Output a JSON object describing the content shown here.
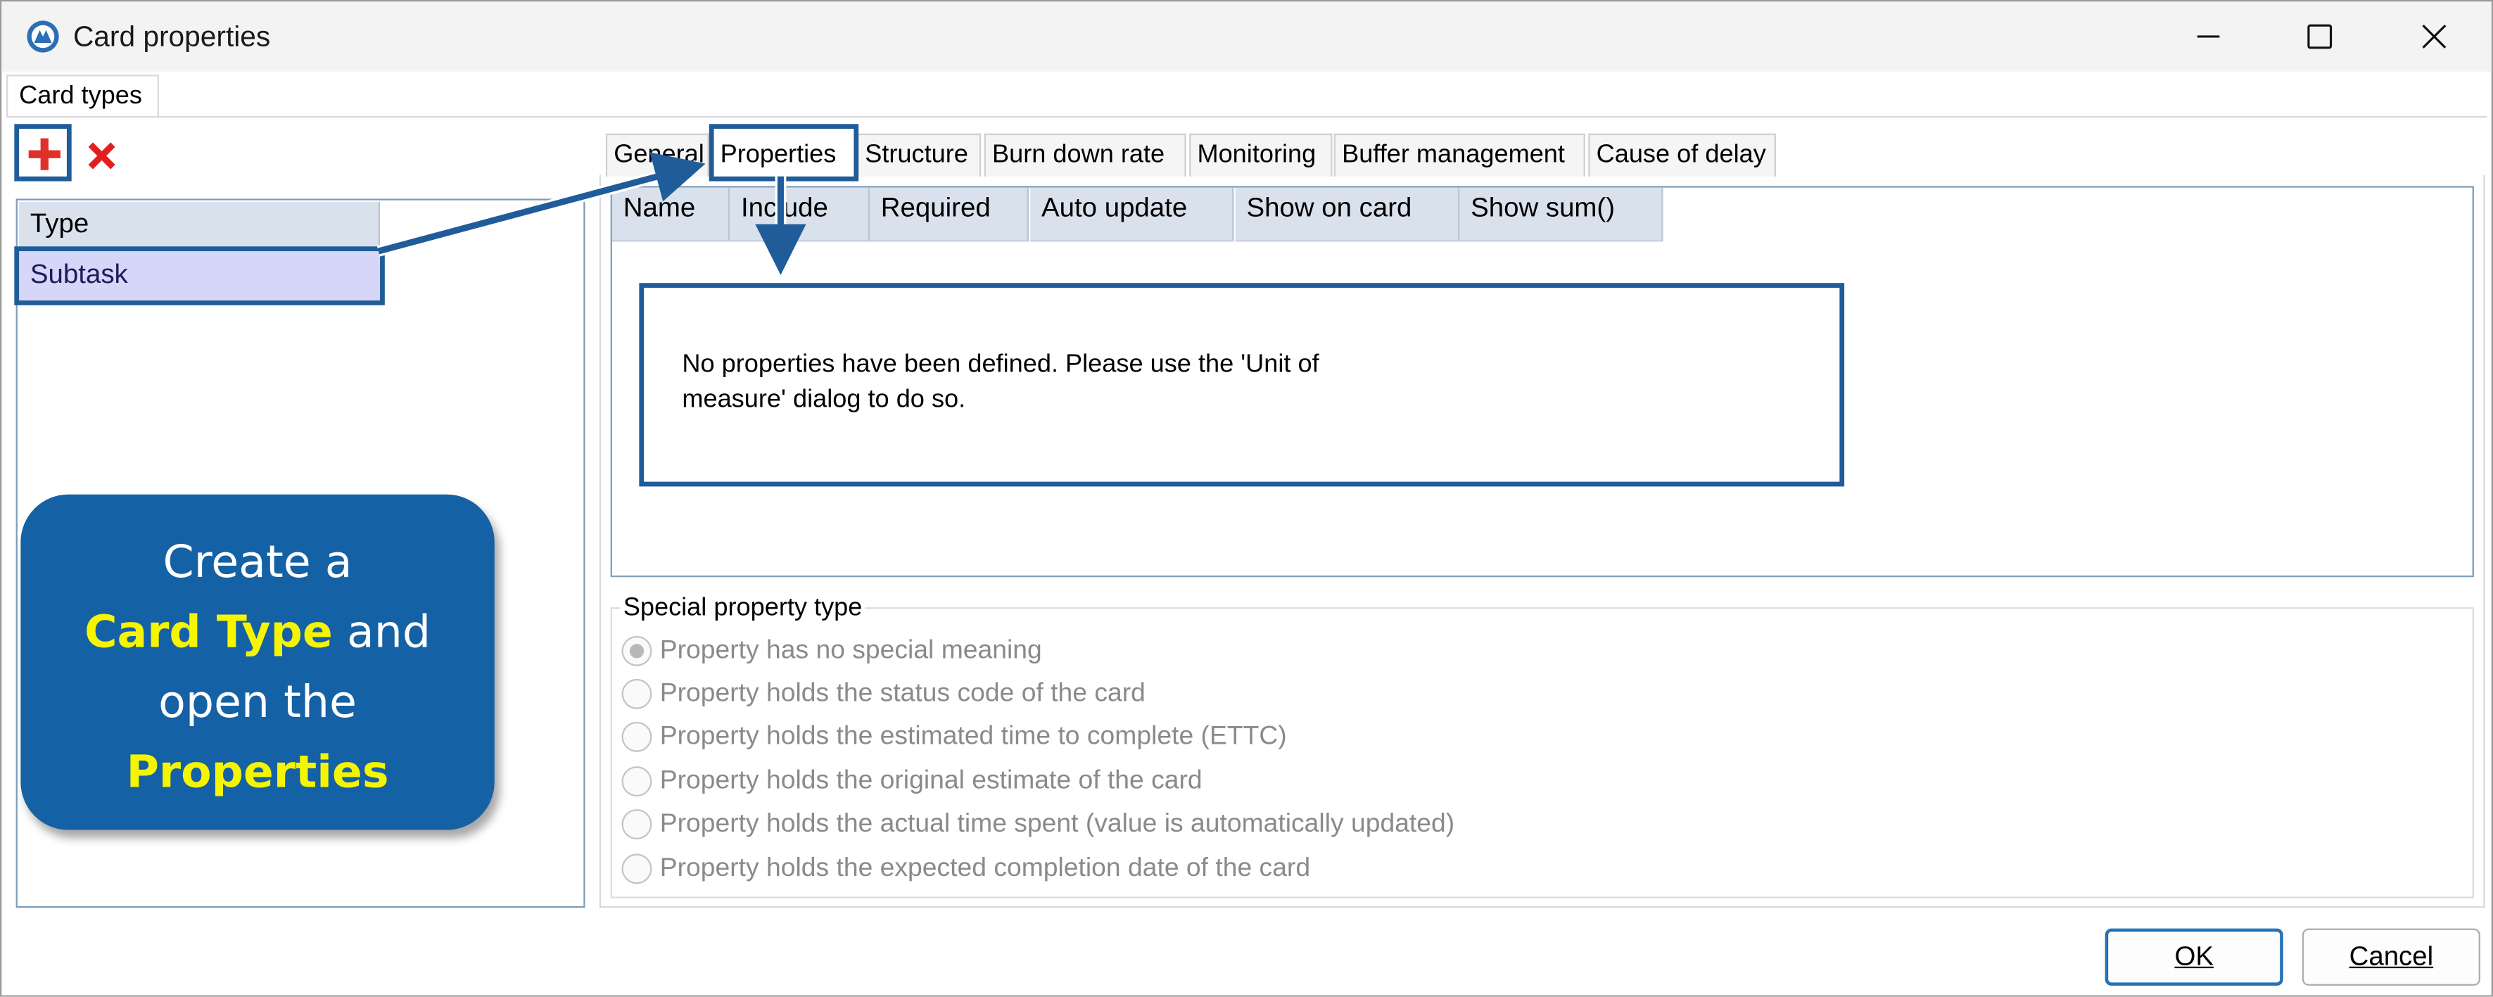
{
  "window": {
    "title": "Card properties"
  },
  "top_tab": "Card types",
  "type_list": {
    "header": "Type",
    "items": [
      "Subtask"
    ]
  },
  "tabs": [
    "General",
    "Properties",
    "Structure",
    "Burn down rate",
    "Monitoring",
    "Buffer management",
    "Cause of delay"
  ],
  "active_tab": "Properties",
  "columns": [
    "Name",
    "Include",
    "Required",
    "Auto update",
    "Show on card",
    "Show sum()"
  ],
  "message": "No properties have been defined. Please use the 'Unit of measure' dialog to do so.",
  "special": {
    "title": "Special property type",
    "options": [
      "Property has no special meaning",
      "Property holds the status code of the card",
      "Property holds the estimated time to complete (ETTC)",
      "Property holds the original estimate of the card",
      "Property holds the actual time spent (value is automatically updated)",
      "Property holds the expected completion date of the card"
    ],
    "selected_index": 0
  },
  "buttons": {
    "ok": "OK",
    "cancel": "Cancel"
  },
  "callout": {
    "line1": "Create a",
    "highlight1": "Card Type",
    "line2_rest": " and",
    "line3": "open the",
    "highlight2": "Properties"
  },
  "colors": {
    "annotation_blue": "#1f5c99",
    "callout_blue": "#1561a5",
    "highlight_yellow": "#f6f500",
    "delete_red": "#e02020",
    "add_red": "#e0302a"
  }
}
